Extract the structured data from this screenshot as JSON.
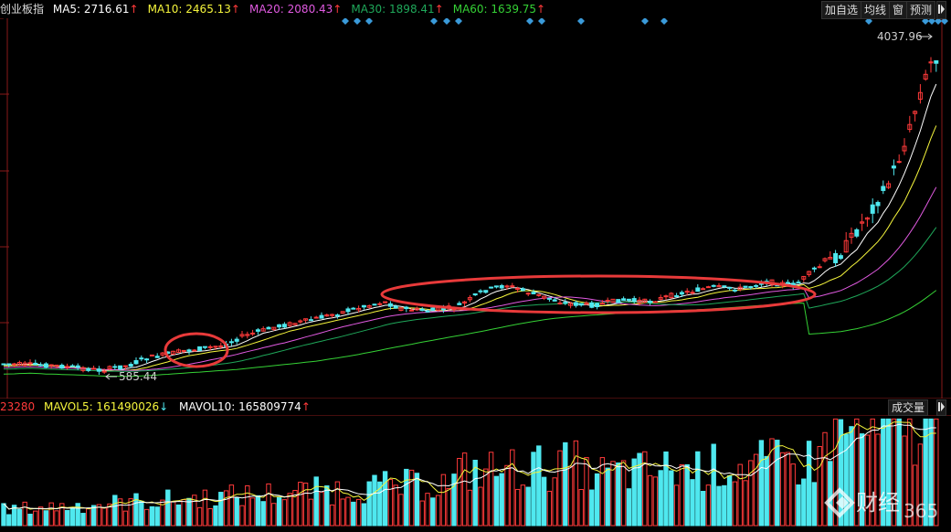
{
  "header": {
    "title": "创业板指",
    "ma_items": [
      {
        "label": "MA5: 2716.61",
        "color": "#ffffff",
        "dir": "up"
      },
      {
        "label": "MA10: 2465.13",
        "color": "#f5f53c",
        "dir": "up"
      },
      {
        "label": "MA20: 2080.43",
        "color": "#e15ae1",
        "dir": "up"
      },
      {
        "label": "MA30: 1898.41",
        "color": "#1fa85a",
        "dir": "up"
      },
      {
        "label": "MA60: 1639.75",
        "color": "#35d135",
        "dir": "up"
      }
    ],
    "buttons": [
      "加自选",
      "均线",
      "窗",
      "预测"
    ]
  },
  "volume_header": {
    "vol_label": "23280",
    "mavol5_label": "MAVOL5: 161490026",
    "mavol5_dir": "down",
    "mavol10_label": "MAVOL10: 165809774",
    "mavol10_dir": "up",
    "indicator_button": "成交量"
  },
  "annotations": {
    "high_label": "4037.96",
    "low_label": "585.44"
  },
  "watermark": {
    "brand": "财经",
    "number": "365"
  },
  "colors": {
    "up": "#ff3a3a",
    "down": "#4fe8ef",
    "frame": "#8a1a1a",
    "circle": "#e83a3a",
    "diamond": "#3a9ad9"
  },
  "chart_data": {
    "type": "candlestick",
    "price_high": 4037.96,
    "price_low": 585.44,
    "ma_series": [
      "MA5",
      "MA10",
      "MA20",
      "MA30",
      "MA60"
    ],
    "volume_series": [
      "VOL",
      "MAVOL5",
      "MAVOL10"
    ]
  }
}
